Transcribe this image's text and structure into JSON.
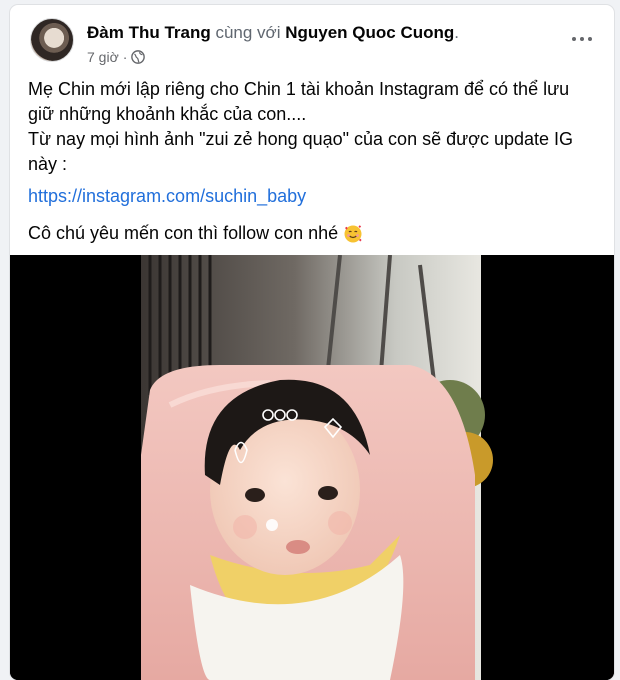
{
  "post": {
    "author_name": "Đàm Thu Trang",
    "with_text": "cùng với",
    "tagged_name": "Nguyen Quoc Cuong",
    "trailing_punct": ".",
    "timestamp": "7 giờ",
    "separator": "·",
    "privacy_icon": "globe-icon",
    "more_icon": "more-horizontal-icon",
    "body_line_1": "Mẹ Chin mới lập riêng cho Chin 1 tài khoản Instagram để có thể lưu giữ những khoảnh khắc của con....",
    "body_line_2": "Từ nay mọi hình ảnh \"zui zẻ hong quạo\" của con sẽ được update IG này :",
    "link": "https://instagram.com/suchin_baby",
    "closing_text": "Cô chú yêu mến con thì follow con nhé",
    "closing_emoji": "smiling-face-with-hearts-icon"
  },
  "colors": {
    "link": "#216fdb",
    "name": "#050505",
    "meta": "#65676b"
  }
}
